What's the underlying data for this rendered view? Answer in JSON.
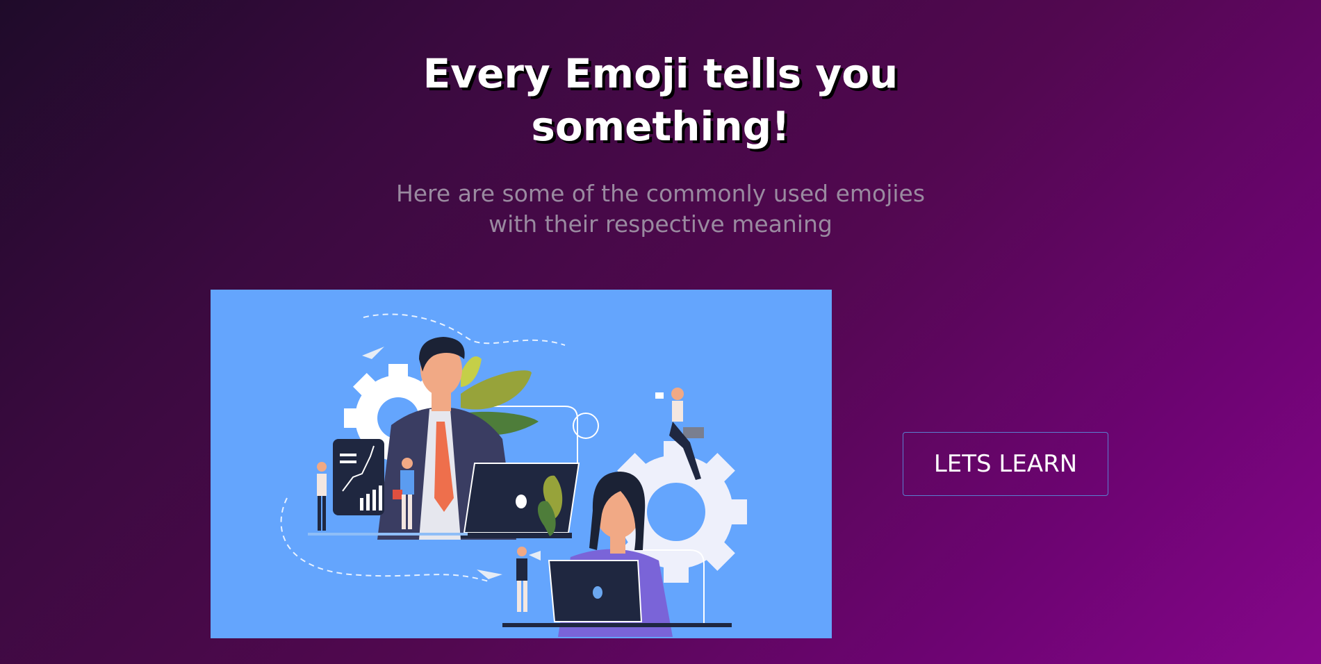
{
  "hero": {
    "title_line1": "Every Emoji tells you",
    "title_line2": "something!",
    "subtitle_line1": "Here are some of the commonly used emojies",
    "subtitle_line2": "with their respective meaning"
  },
  "illustration": {
    "subject": "business-team-illustration",
    "background_color": "#64a5fd"
  },
  "cta": {
    "label": "LETS LEARN",
    "border_color": "#5a7fd0"
  },
  "colors": {
    "gradient_start": "#1f0b2a",
    "gradient_end": "#85068a",
    "title": "#ffffff",
    "subtitle": "#9a8aa0"
  }
}
